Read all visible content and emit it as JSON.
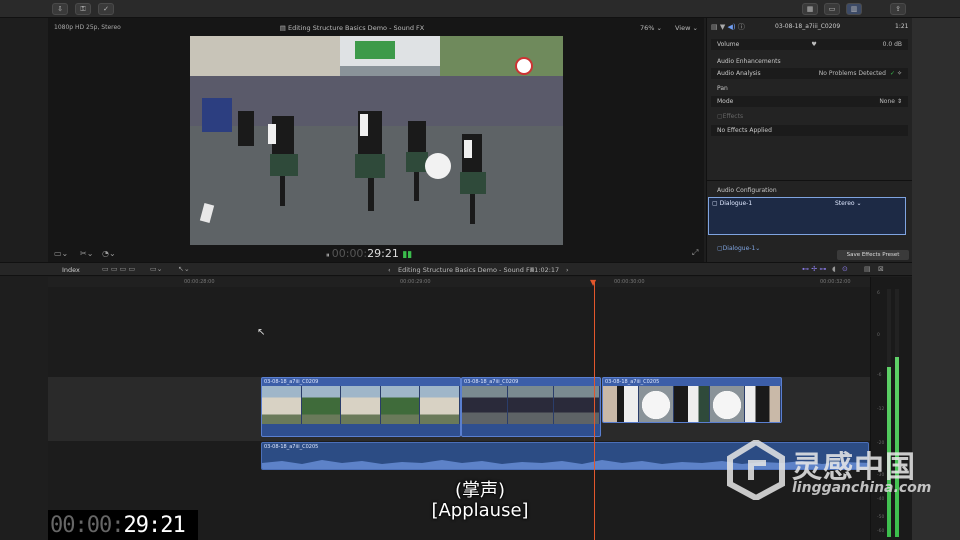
{
  "viewer": {
    "format": "1080p HD 25p, Stereo",
    "title": "Editing Structure Basics Demo - Sound FX",
    "zoom": "76%",
    "view_menu": "View",
    "timecode_dim": "00:00:",
    "timecode": "29:21"
  },
  "inspector": {
    "clip_name": "03-08-18_a7iii_C0209",
    "duration": "1:21",
    "volume_label": "Volume",
    "volume_value": "0.0 dB",
    "enhancements_label": "Audio Enhancements",
    "analysis_label": "Audio Analysis",
    "analysis_value": "No Problems Detected",
    "pan_label": "Pan",
    "mode_label": "Mode",
    "mode_value": "None",
    "effects_label": "Effects",
    "effects_value": "No Effects Applied",
    "config_label": "Audio Configuration",
    "config_item": "Dialogue-1",
    "config_item_value": "Stereo",
    "config_item2": "Dialogue-1",
    "save_preset": "Save Effects Preset"
  },
  "timeline_bar": {
    "index": "Index",
    "title": "Editing Structure Basics Demo - Sound FX",
    "duration": "01:02:17"
  },
  "ruler": {
    "ticks": [
      "00:00:28:00",
      "00:00:29:00",
      "00:00:30:00",
      "00:00:32:00"
    ]
  },
  "clips": [
    {
      "name": "03-08-18_a7iii_C0209"
    },
    {
      "name": "03-08-18_a7iii_C0209"
    },
    {
      "name": "03-08-18_a7iii_C0205"
    }
  ],
  "audio_clip": {
    "name": "03-08-18_a7iii_C0205"
  },
  "meters": {
    "scale": [
      "6",
      "0",
      "-6",
      "-12",
      "-20",
      "-30",
      "-40",
      "-50",
      "-60"
    ]
  },
  "overlay": {
    "timecode_dim": "00:00:",
    "timecode": "29:21"
  },
  "subtitles": {
    "cn": "(掌声)",
    "en": "[Applause]"
  },
  "watermark": {
    "name": "灵感中国",
    "url": "lingganchina.com"
  },
  "colors": {
    "accent": "#3c5ea8",
    "playhead": "#e2572c",
    "meter": "#3bbd4c"
  }
}
